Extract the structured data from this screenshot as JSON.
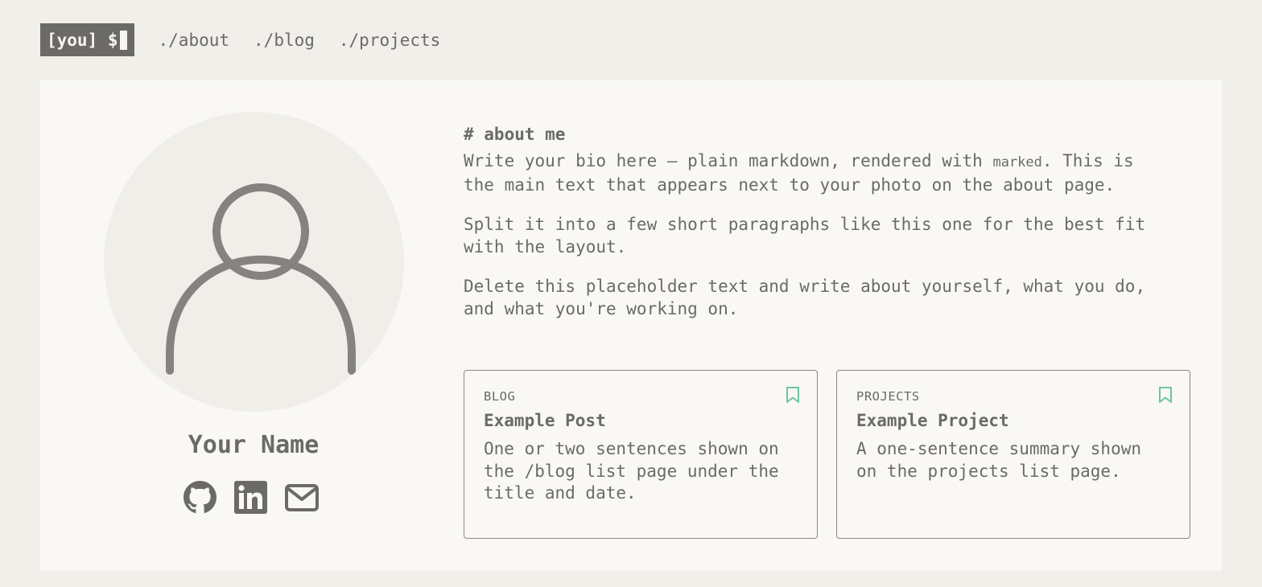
{
  "header": {
    "logo_text": "[you] $",
    "nav": [
      {
        "label": "./about"
      },
      {
        "label": "./blog"
      },
      {
        "label": "./projects"
      }
    ]
  },
  "profile": {
    "name": "Your Name",
    "socials": [
      {
        "icon": "github-icon"
      },
      {
        "icon": "linkedin-icon"
      },
      {
        "icon": "mail-icon"
      }
    ]
  },
  "about": {
    "heading": "# about me",
    "p1_before": "Write your bio here — plain markdown, rendered with ",
    "p1_code": "marked",
    "p1_after": ". This is the main text that appears next to your photo on the about page.",
    "p2": "Split it into a few short paragraphs like this one for the best fit with the layout.",
    "p3": "Delete this placeholder text and write about yourself, what you do, and what you're working on."
  },
  "cards": [
    {
      "tag": "BLOG",
      "title": "Example Post",
      "text": "One or two sentences shown on the /blog list page under the title and date."
    },
    {
      "tag": "PROJECTS",
      "title": "Example Project",
      "text": "A one-sentence summary shown on the projects list page."
    }
  ],
  "colors": {
    "background": "#f1efe9",
    "panel": "#f9f8f4",
    "text": "#6b6a66",
    "accent": "#6cc4a4"
  }
}
